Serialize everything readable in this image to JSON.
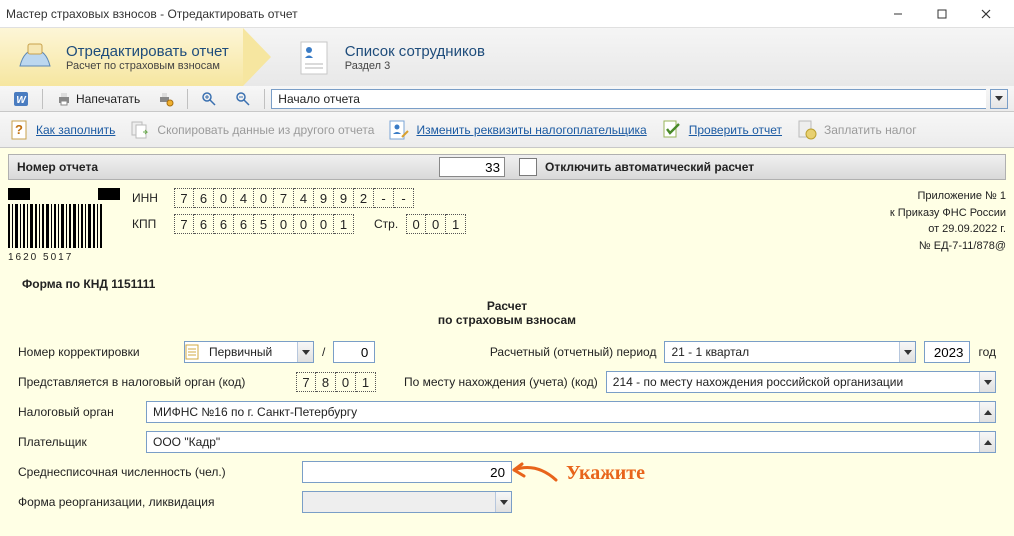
{
  "window": {
    "title": "Мастер страховых взносов - Отредактировать отчет"
  },
  "wizard": {
    "step1": {
      "title": "Отредактировать отчет",
      "subtitle": "Расчет по страховым взносам"
    },
    "step2": {
      "title": "Список сотрудников",
      "subtitle": "Раздел 3"
    }
  },
  "toolbar1": {
    "print": "Напечатать",
    "section_combo": "Начало отчета"
  },
  "toolbar2": {
    "how": "Как заполнить",
    "copy": "Скопировать данные из другого отчета",
    "change_req": "Изменить реквизиты налогоплательщика",
    "check": "Проверить отчет",
    "pay": "Заплатить налог"
  },
  "doc": {
    "report_number_label": "Номер отчета",
    "report_number": "33",
    "disable_auto_label": "Отключить автоматический расчет",
    "inn_label": "ИНН",
    "inn_cells": [
      "7",
      "6",
      "0",
      "4",
      "0",
      "7",
      "4",
      "9",
      "9",
      "2",
      "-",
      "-"
    ],
    "kpp_label": "КПП",
    "kpp_cells": [
      "7",
      "6",
      "6",
      "6",
      "5",
      "0",
      "0",
      "0",
      "1"
    ],
    "page_label": "Стр.",
    "page_cells": [
      "0",
      "0",
      "1"
    ],
    "barcode_number": "1620 5017",
    "right_info": {
      "l1": "Приложение № 1",
      "l2": "к Приказу ФНС России",
      "l3": "от 29.09.2022 г.",
      "l4": "№ ЕД-7-11/878@"
    },
    "knd": "Форма по КНД 1151111",
    "title_line1": "Расчет",
    "title_line2": "по страховым взносам",
    "correction_label": "Номер корректировки",
    "correction_type": "Первичный",
    "correction_num": "0",
    "period_label": "Расчетный (отчетный) период",
    "period_value": "21 - 1 квартал",
    "year_value": "2023",
    "year_label": "год",
    "tax_code_label": "Представляется в налоговый орган (код)",
    "tax_code_cells": [
      "7",
      "8",
      "0",
      "1"
    ],
    "place_label": "По месту нахождения (учета) (код)",
    "place_value": "214 - по месту нахождения российской организации",
    "tax_org_label": "Налоговый орган",
    "tax_org_value": "МИФНС №16 по г. Санкт-Петербургу",
    "payer_label": "Плательщик",
    "payer_value": "ООО \"Кадр\"",
    "headcount_label": "Среднесписочная численность (чел.)",
    "headcount_value": "20",
    "reorg_label": "Форма реорганизации, ликвидация"
  },
  "annotation": {
    "text": "Укажите"
  }
}
